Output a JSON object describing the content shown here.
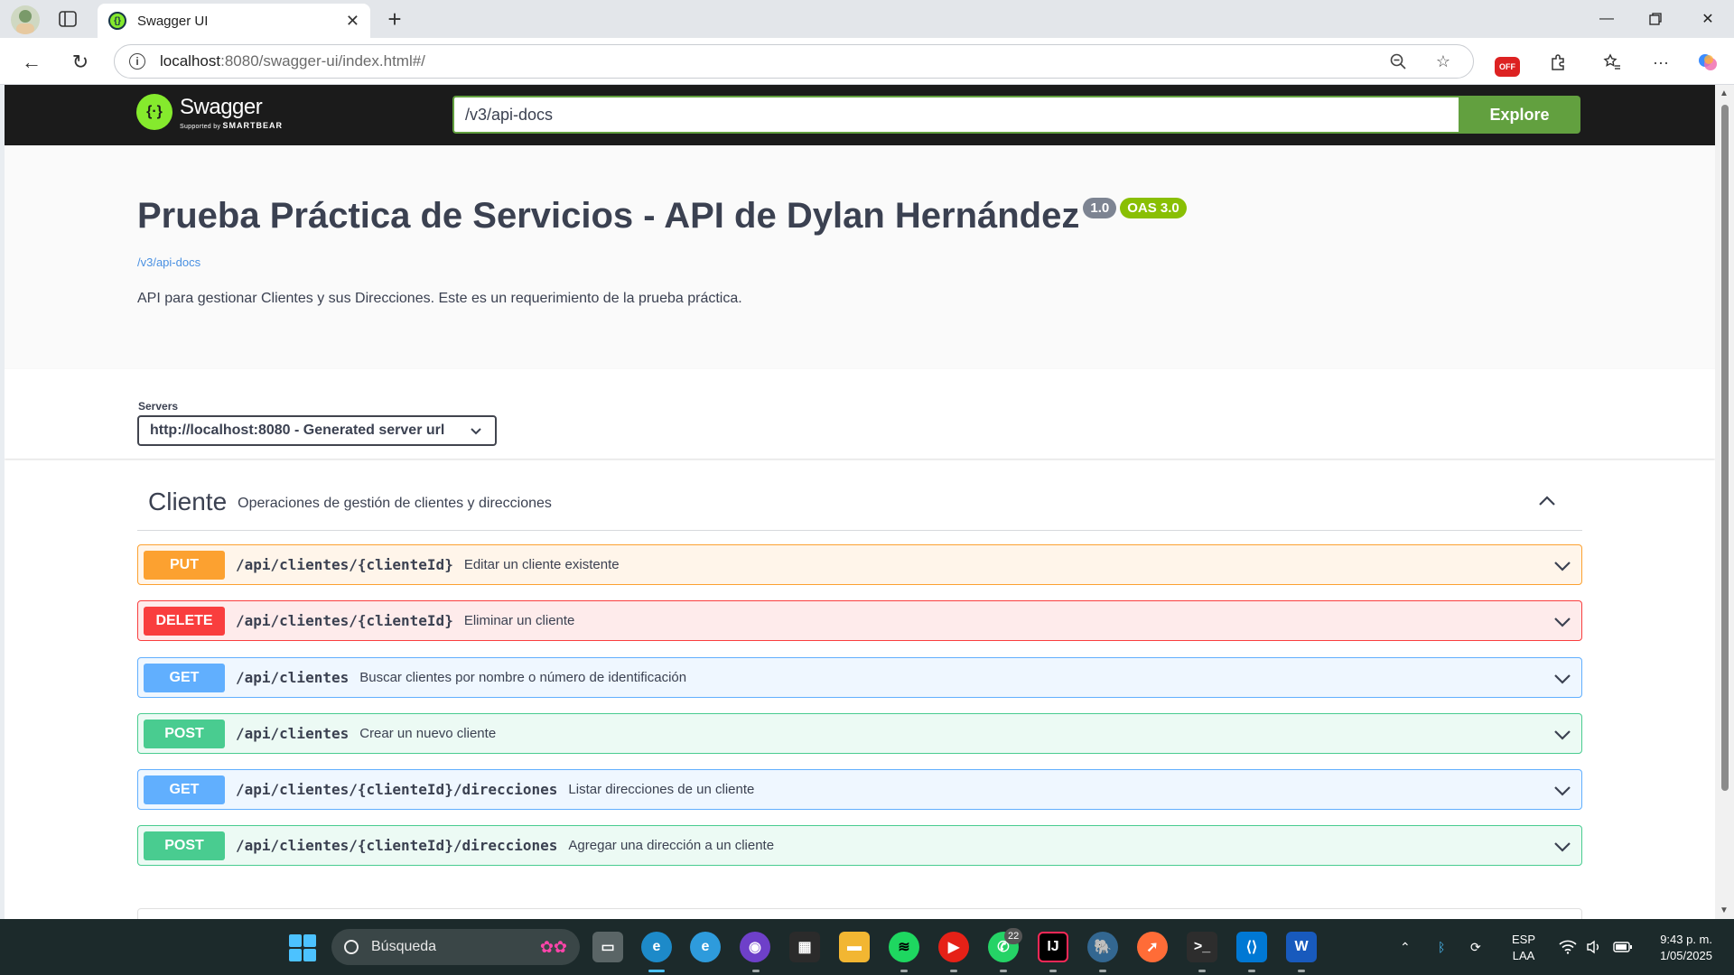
{
  "browser": {
    "tab_title": "Swagger UI",
    "url_host": "localhost",
    "url_path": ":8080/swagger-ui/index.html#/",
    "ext_badge": "OFF"
  },
  "swagger": {
    "logo_name": "Swagger",
    "logo_sub_prefix": "Supported by",
    "logo_sub_brand": "SMARTBEAR",
    "spec_url": "/v3/api-docs",
    "explore_label": "Explore"
  },
  "info": {
    "title": "Prueba Práctica de Servicios - API de Dylan Hernández",
    "version_badge": "1.0",
    "oas_badge": "OAS 3.0",
    "spec_link": "/v3/api-docs",
    "description": "API para gestionar Clientes y sus Direcciones. Este es un requerimiento de la prueba práctica."
  },
  "servers": {
    "label": "Servers",
    "selected": "http://localhost:8080 - Generated server url"
  },
  "tag": {
    "name": "Cliente",
    "description": "Operaciones de gestión de clientes y direcciones"
  },
  "operations": [
    {
      "method": "PUT",
      "path": "/api/clientes/{clienteId}",
      "summary": "Editar un cliente existente"
    },
    {
      "method": "DELETE",
      "path": "/api/clientes/{clienteId}",
      "summary": "Eliminar un cliente"
    },
    {
      "method": "GET",
      "path": "/api/clientes",
      "summary": "Buscar clientes por nombre o número de identificación"
    },
    {
      "method": "POST",
      "path": "/api/clientes",
      "summary": "Crear un nuevo cliente"
    },
    {
      "method": "GET",
      "path": "/api/clientes/{clienteId}/direcciones",
      "summary": "Listar direcciones de un cliente"
    },
    {
      "method": "POST",
      "path": "/api/clientes/{clienteId}/direcciones",
      "summary": "Agregar una dirección a un cliente"
    }
  ],
  "taskbar": {
    "search_placeholder": "Búsqueda",
    "whatsapp_badge": "22",
    "lang_line1": "ESP",
    "lang_line2": "LAA",
    "time": "9:43 p. m.",
    "date": "1/05/2025"
  },
  "colors": {
    "put": "#fca130",
    "delete": "#f93e3e",
    "get": "#61affe",
    "post": "#49cc90",
    "swagger_green": "#62a03f",
    "topbar": "#1b1b1b"
  }
}
